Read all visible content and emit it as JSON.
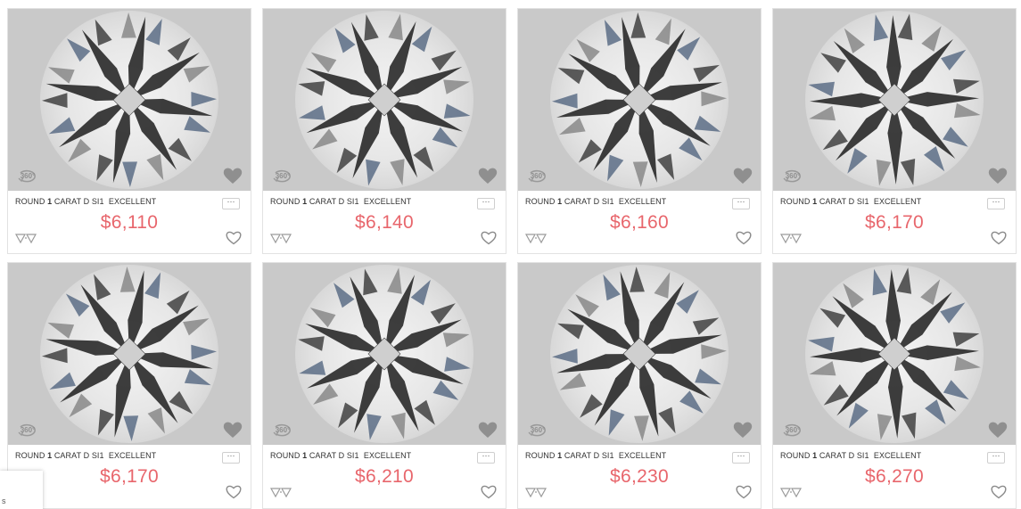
{
  "listing": {
    "items": [
      {
        "shape": "ROUND",
        "carat": "1",
        "carat_unit": "CARAT",
        "color": "D",
        "clarity": "SI1",
        "cut": "EXCELLENT",
        "price": "$6,110",
        "spin_label": "360°"
      },
      {
        "shape": "ROUND",
        "carat": "1",
        "carat_unit": "CARAT",
        "color": "D",
        "clarity": "SI1",
        "cut": "EXCELLENT",
        "price": "$6,140",
        "spin_label": "360°"
      },
      {
        "shape": "ROUND",
        "carat": "1",
        "carat_unit": "CARAT",
        "color": "D",
        "clarity": "SI1",
        "cut": "EXCELLENT",
        "price": "$6,160",
        "spin_label": "360°"
      },
      {
        "shape": "ROUND",
        "carat": "1",
        "carat_unit": "CARAT",
        "color": "D",
        "clarity": "SI1",
        "cut": "EXCELLENT",
        "price": "$6,170",
        "spin_label": "360°"
      },
      {
        "shape": "ROUND",
        "carat": "1",
        "carat_unit": "CARAT",
        "color": "D",
        "clarity": "SI1",
        "cut": "EXCELLENT",
        "price": "$6,170",
        "spin_label": "360°"
      },
      {
        "shape": "ROUND",
        "carat": "1",
        "carat_unit": "CARAT",
        "color": "D",
        "clarity": "SI1",
        "cut": "EXCELLENT",
        "price": "$6,210",
        "spin_label": "360°"
      },
      {
        "shape": "ROUND",
        "carat": "1",
        "carat_unit": "CARAT",
        "color": "D",
        "clarity": "SI1",
        "cut": "EXCELLENT",
        "price": "$6,230",
        "spin_label": "360°"
      },
      {
        "shape": "ROUND",
        "carat": "1",
        "carat_unit": "CARAT",
        "color": "D",
        "clarity": "SI1",
        "cut": "EXCELLENT",
        "price": "$6,270",
        "spin_label": "360°"
      }
    ],
    "more_label": "···"
  },
  "toast": {
    "text": "s"
  },
  "icons": {
    "spin": "360-view-icon",
    "favorite_overlay": "heart-filled-icon",
    "compare": "ring-compare-icon",
    "wishlist": "heart-outline-icon"
  },
  "colors": {
    "price": "#e8666c",
    "image_bg": "#c9c9c9",
    "card_border": "#e2e2e2"
  }
}
